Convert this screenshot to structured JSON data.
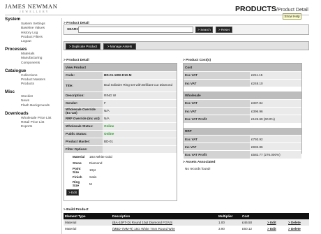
{
  "logo": {
    "main": "JAMES NEWMAN",
    "sub": "JEWELLERY"
  },
  "heading": {
    "main": "PRODUCTS",
    "sub": "/Product Detail"
  },
  "help_button": "Show Help",
  "sidebar": [
    {
      "heading": "System",
      "items": [
        "System Settings",
        "Baseline Values",
        "History Log",
        "Product Filters",
        "Logout"
      ]
    },
    {
      "heading": "Processes",
      "items": [
        "Materials",
        "Manufacturing",
        "Components"
      ]
    },
    {
      "heading": "Catalogue",
      "items": [
        "Collections",
        "Product Masters",
        "Products"
      ]
    },
    {
      "heading": "Misc",
      "items": [
        "Stockist",
        "News",
        "Flash Backgrounds"
      ]
    },
    {
      "heading": "Downloads",
      "items": [
        "Wholesale Price List",
        "Retail Price List",
        "Exports"
      ]
    }
  ],
  "product_search": {
    "section_title": "> Product Detail",
    "search_label": "SEARCH",
    "search_value": "",
    "search_button": "> Search",
    "reset_button": "> Reset"
  },
  "actions": {
    "duplicate": "> Duplicate Product",
    "manage_assets": "> Manage Assets"
  },
  "detail": {
    "section_title": "> Product Detail",
    "header": "View Product",
    "rows": [
      {
        "label": "Code:",
        "value": "BD-01-18W-D10-M",
        "bold": true
      },
      {
        "label": "Title:",
        "value": "Bud Solitaire Ring set with Brilliant Cut Diamond"
      },
      {
        "label": "Description:",
        "value": "RING W"
      },
      {
        "label": "Gender:",
        "value": "F"
      },
      {
        "label": "Wholesale Override (Ex vat)",
        "value": "N/A"
      },
      {
        "label": "RRP Override (Inc vat)",
        "value": "N/A"
      },
      {
        "label": "Wholesale Status:",
        "value": "Online",
        "green": true
      },
      {
        "label": "Public Status:",
        "value": "Online",
        "green": true
      },
      {
        "label": "Product Master:",
        "value": "BD-01"
      }
    ],
    "filter_label": "Filter Options:",
    "filters": [
      {
        "label": "Material",
        "value": "18ct White Gold"
      },
      {
        "label": "Stone",
        "value": "Diamond"
      },
      {
        "label": "Point Size",
        "value": "10pt"
      },
      {
        "label": "Finish",
        "value": "Satin"
      },
      {
        "label": "Ring Size",
        "value": "M"
      }
    ],
    "edit_button": "> Edit"
  },
  "costs": {
    "section_title": "> Product Cost(s)",
    "groups": [
      {
        "header": "Cost",
        "rows": [
          {
            "label": "Exc VAT",
            "value": "£211.15"
          },
          {
            "label": "Inc VAT",
            "value": "£248.10"
          }
        ]
      },
      {
        "header": "Wholesale",
        "rows": [
          {
            "label": "Exc VAT",
            "value": "£337.84"
          },
          {
            "label": "Inc VAT",
            "value": "£396.96"
          },
          {
            "label": "Exc VAT Profit",
            "value": "£126.69 (60.0%)"
          }
        ]
      },
      {
        "header": "RRP",
        "rows": [
          {
            "label": "Exc VAT",
            "value": "£793.92"
          },
          {
            "label": "Inc VAT",
            "value": "£932.86"
          },
          {
            "label": "Exc VAT Profit",
            "value": "£582.77 (276.000%)"
          }
        ]
      }
    ]
  },
  "assets": {
    "section_title": "> Assets Associated",
    "empty": "No records found!"
  },
  "build": {
    "section_title": "> Build Product",
    "columns": [
      "Element Type",
      "Description",
      "Multiplier",
      "Cost",
      "",
      ""
    ],
    "rows": [
      {
        "type": "Material",
        "description": "(BA-10PT-D) Round 10pt Diamond FG/VS",
        "multiplier": "1.00",
        "cost": "£46.50",
        "edit": "> Edit",
        "delete": "> Delete"
      },
      {
        "type": "Material",
        "description": "(MBD-7MM-R) 18ct White 7mm Round Wire",
        "multiplier": "3.90",
        "cost": "£60.12",
        "edit": "> Edit",
        "delete": "> Delete"
      }
    ]
  }
}
